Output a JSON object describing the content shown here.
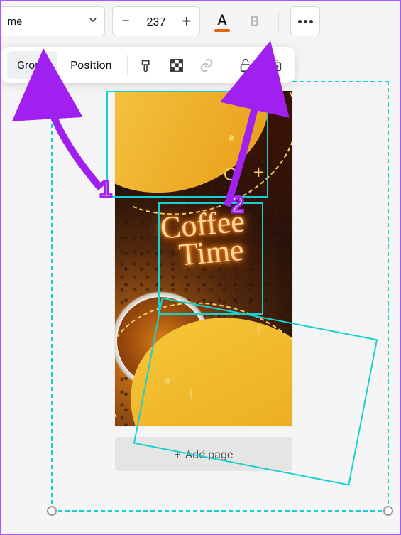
{
  "toolbar": {
    "font_name": "me",
    "font_size": "237",
    "bold_label": "B",
    "text_color_letter": "A",
    "text_color_hex": "#e8610c"
  },
  "context": {
    "group_label": "Group",
    "position_label": "Position"
  },
  "canvas": {
    "title_line1": "Coffee",
    "title_line2": "Time"
  },
  "actions": {
    "add_page_label": "Add page"
  },
  "annotations": {
    "label1": "1",
    "label2": "2"
  }
}
